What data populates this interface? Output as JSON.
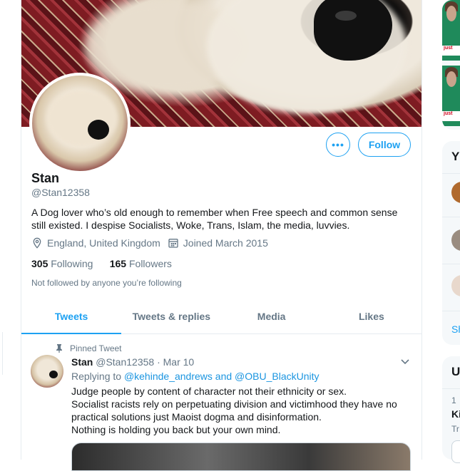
{
  "profile": {
    "name": "Stan",
    "handle": "@Stan12358",
    "bio": "A Dog lover who’s old enough to remember when Free speech and common sense still existed. I despise Socialists, Woke, Trans, Islam, the media, luvvies.",
    "location": "England, United Kingdom",
    "joined": "Joined March 2015",
    "following_count": "305",
    "following_label": "Following",
    "followers_count": "165",
    "followers_label": "Followers",
    "not_followed_text": "Not followed by anyone you’re following"
  },
  "actions": {
    "more_label": "•••",
    "follow_label": "Follow"
  },
  "tabs": [
    {
      "label": "Tweets",
      "active": true
    },
    {
      "label": "Tweets & replies",
      "active": false
    },
    {
      "label": "Media",
      "active": false
    },
    {
      "label": "Likes",
      "active": false
    }
  ],
  "tweet": {
    "pinned_label": "Pinned Tweet",
    "author_name": "Stan",
    "author_handle": "@Stan12358",
    "separator": "·",
    "date": "Mar 10",
    "replying_prefix": "Replying to ",
    "replying_targets": "@kehinde_andrews and @OBU_BlackUnity",
    "text_lines": [
      "Judge people by content of character not their ethnicity or sex.",
      "Socialist racists rely on perpetuating division and victimhood they have no practical solutions just Maoist dogma and disinformation.",
      "Nothing is holding you back but your own mind."
    ]
  },
  "sidebar": {
    "thumb_text": "just",
    "who_to_follow_initial": "Y",
    "show_more_fragment": "Sh",
    "trends_initial": "U",
    "trend_rank": "1",
    "trend_title_fragment": "Ki",
    "trend_meta_fragment": "Tr"
  },
  "colors": {
    "accent": "#1da1f2",
    "secondary_text": "#657786",
    "border": "#e6ecf0"
  },
  "icons": {
    "location": "location-pin-icon",
    "calendar": "calendar-icon",
    "pin": "pin-icon",
    "caret": "chevron-down-icon"
  }
}
